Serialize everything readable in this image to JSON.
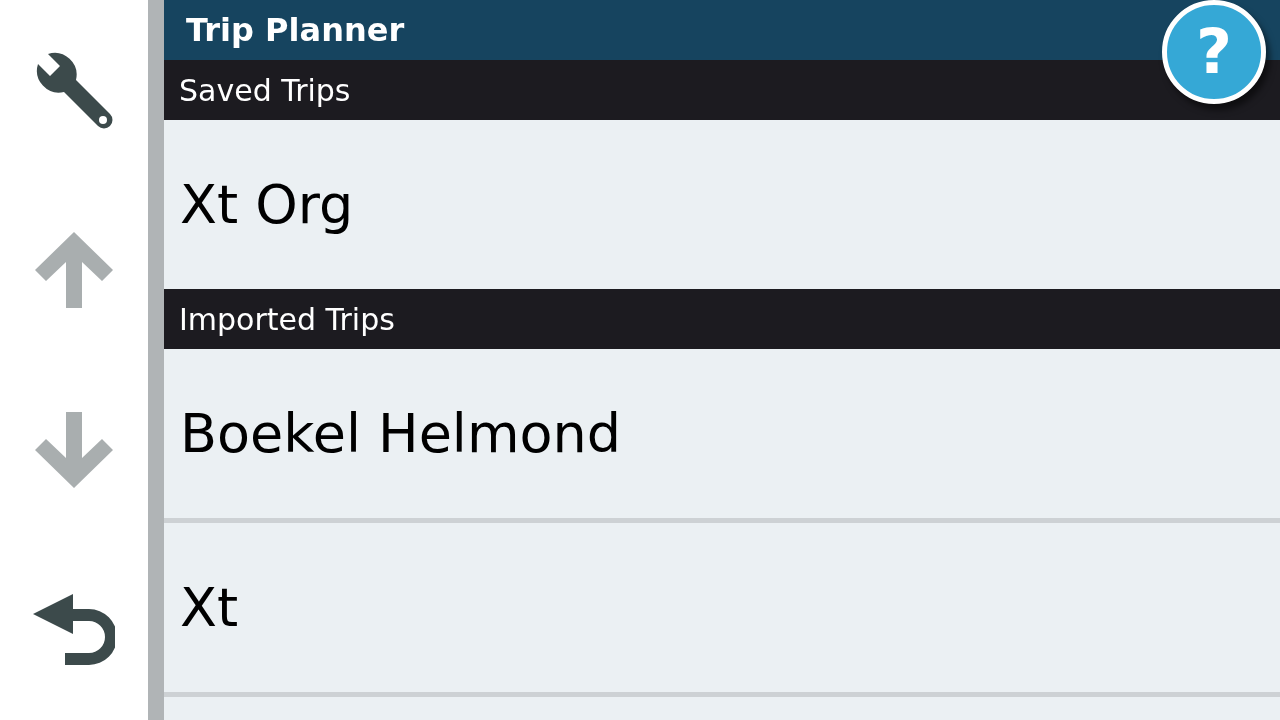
{
  "sidebar": {
    "buttons": [
      {
        "kind": "settings",
        "disabled": false
      },
      {
        "kind": "up",
        "disabled": true
      },
      {
        "kind": "down",
        "disabled": true
      },
      {
        "kind": "back",
        "disabled": false
      }
    ]
  },
  "header": {
    "title": "Trip Planner",
    "help": "?"
  },
  "sections": [
    {
      "title": "Saved Trips",
      "trips": [
        {
          "name": "Xt Org"
        }
      ]
    },
    {
      "title": "Imported Trips",
      "trips": [
        {
          "name": "Boekel Helmond"
        },
        {
          "name": "Xt"
        }
      ]
    }
  ]
}
